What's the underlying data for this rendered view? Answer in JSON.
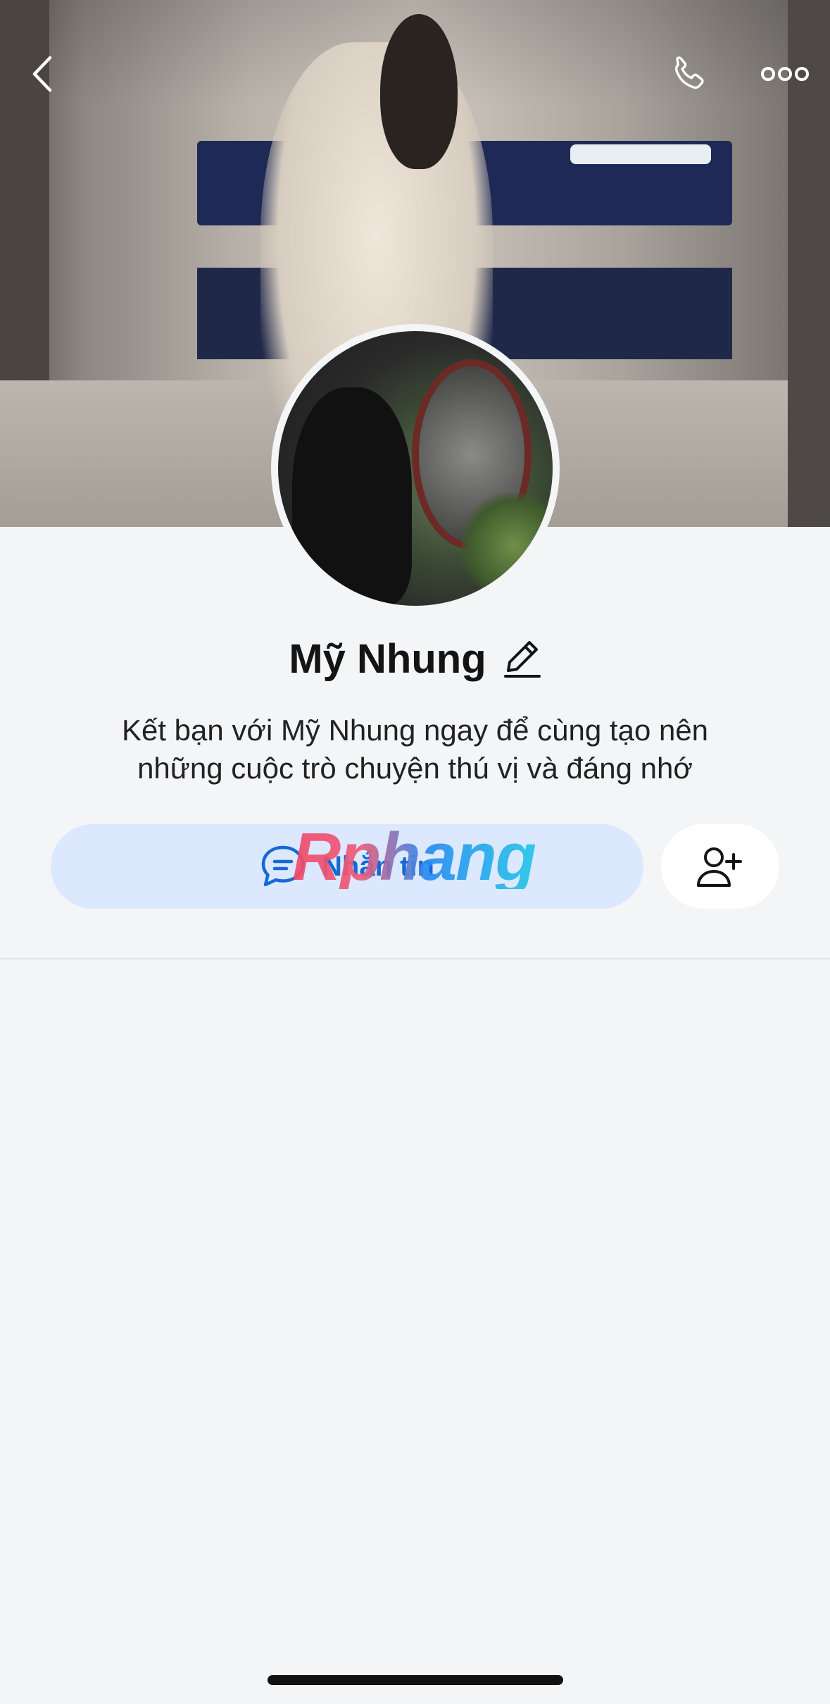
{
  "profile": {
    "name": "Mỹ Nhung",
    "description_line1": "Kết bạn với Mỹ Nhung ngay để cùng tạo nên",
    "description_line2": "những cuộc trò chuyện thú vị và đáng nhớ"
  },
  "actions": {
    "message_label": "Nhắn tin"
  },
  "watermark": {
    "text": "Rphang"
  },
  "icons": {
    "back": "chevron-left-icon",
    "call": "phone-icon",
    "more": "more-dots-icon",
    "edit": "pencil-icon",
    "message": "chat-bubble-icon",
    "add_friend": "add-user-icon"
  },
  "colors": {
    "accent": "#1768d6",
    "message_button_bg": "#dbe8fd",
    "page_bg": "#f4f5f7"
  }
}
